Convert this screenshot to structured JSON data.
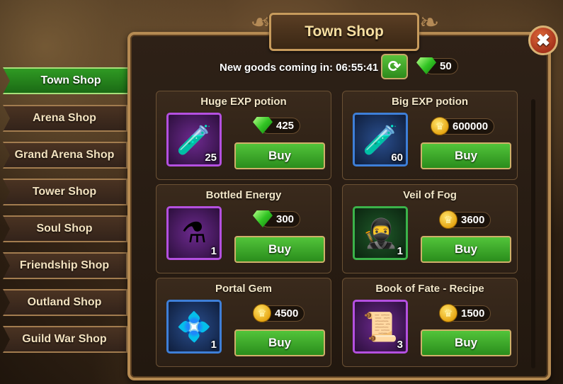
{
  "window": {
    "title": "Town Shop",
    "close_icon": "✖"
  },
  "header": {
    "timer_label": "New goods coming in:",
    "timer_value": "06:55:41",
    "refresh_icon": "⟳",
    "gems": "50"
  },
  "nav": {
    "tabs": [
      {
        "label": "Town Shop",
        "active": true
      },
      {
        "label": "Arena Shop"
      },
      {
        "label": "Grand Arena Shop"
      },
      {
        "label": "Tower Shop"
      },
      {
        "label": "Soul Shop"
      },
      {
        "label": "Friendship Shop"
      },
      {
        "label": "Outland Shop"
      },
      {
        "label": "Guild War Shop"
      }
    ]
  },
  "items": [
    {
      "name": "Huge EXP potion",
      "qty": "25",
      "price": "425",
      "currency": "gem",
      "buy": "Buy",
      "icon": "🧪"
    },
    {
      "name": "Big EXP potion",
      "qty": "60",
      "price": "600000",
      "currency": "gold",
      "buy": "Buy",
      "icon": "🧪"
    },
    {
      "name": "Bottled Energy",
      "qty": "1",
      "price": "300",
      "currency": "gem",
      "buy": "Buy",
      "icon": "⚗"
    },
    {
      "name": "Veil of Fog",
      "qty": "1",
      "price": "3600",
      "currency": "gold",
      "buy": "Buy",
      "icon": "🥷"
    },
    {
      "name": "Portal Gem",
      "qty": "1",
      "price": "4500",
      "currency": "gold",
      "buy": "Buy",
      "icon": "💠"
    },
    {
      "name": "Book of Fate - Recipe",
      "qty": "3",
      "price": "1500",
      "currency": "gold",
      "buy": "Buy",
      "icon": "📜"
    }
  ],
  "colors": {
    "accent_green": "#2f9a23",
    "frame_gold": "#b58a52",
    "title_text": "#f6dea0"
  }
}
